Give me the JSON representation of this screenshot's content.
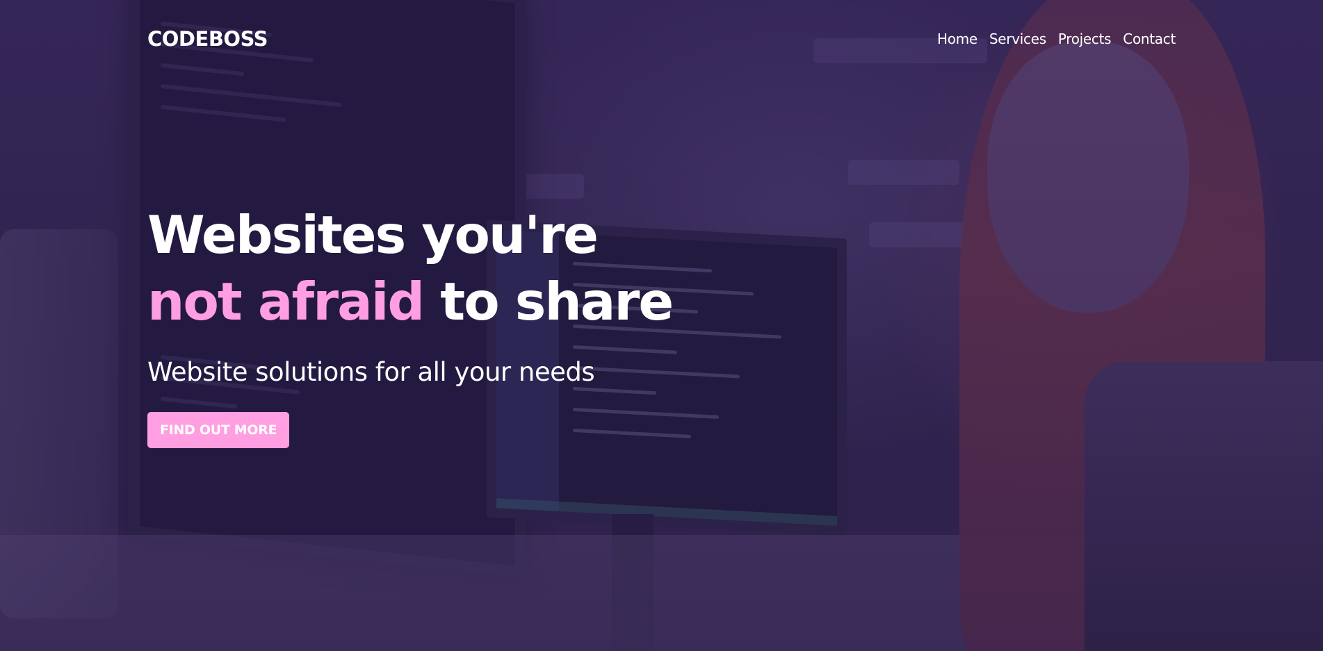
{
  "header": {
    "brand": "CODEBOSS",
    "nav": [
      {
        "label": "Home"
      },
      {
        "label": "Services"
      },
      {
        "label": "Projects"
      },
      {
        "label": "Contact"
      }
    ]
  },
  "hero": {
    "headline_line1": "Websites you're",
    "headline_accent": "not afraid",
    "headline_rest": " to share",
    "subheadline": "Website solutions for all your needs",
    "cta_label": "FIND OUT MORE"
  },
  "colors": {
    "accent": "#ff9ee0",
    "overlay": "#2e1e52",
    "text": "#ffffff"
  }
}
